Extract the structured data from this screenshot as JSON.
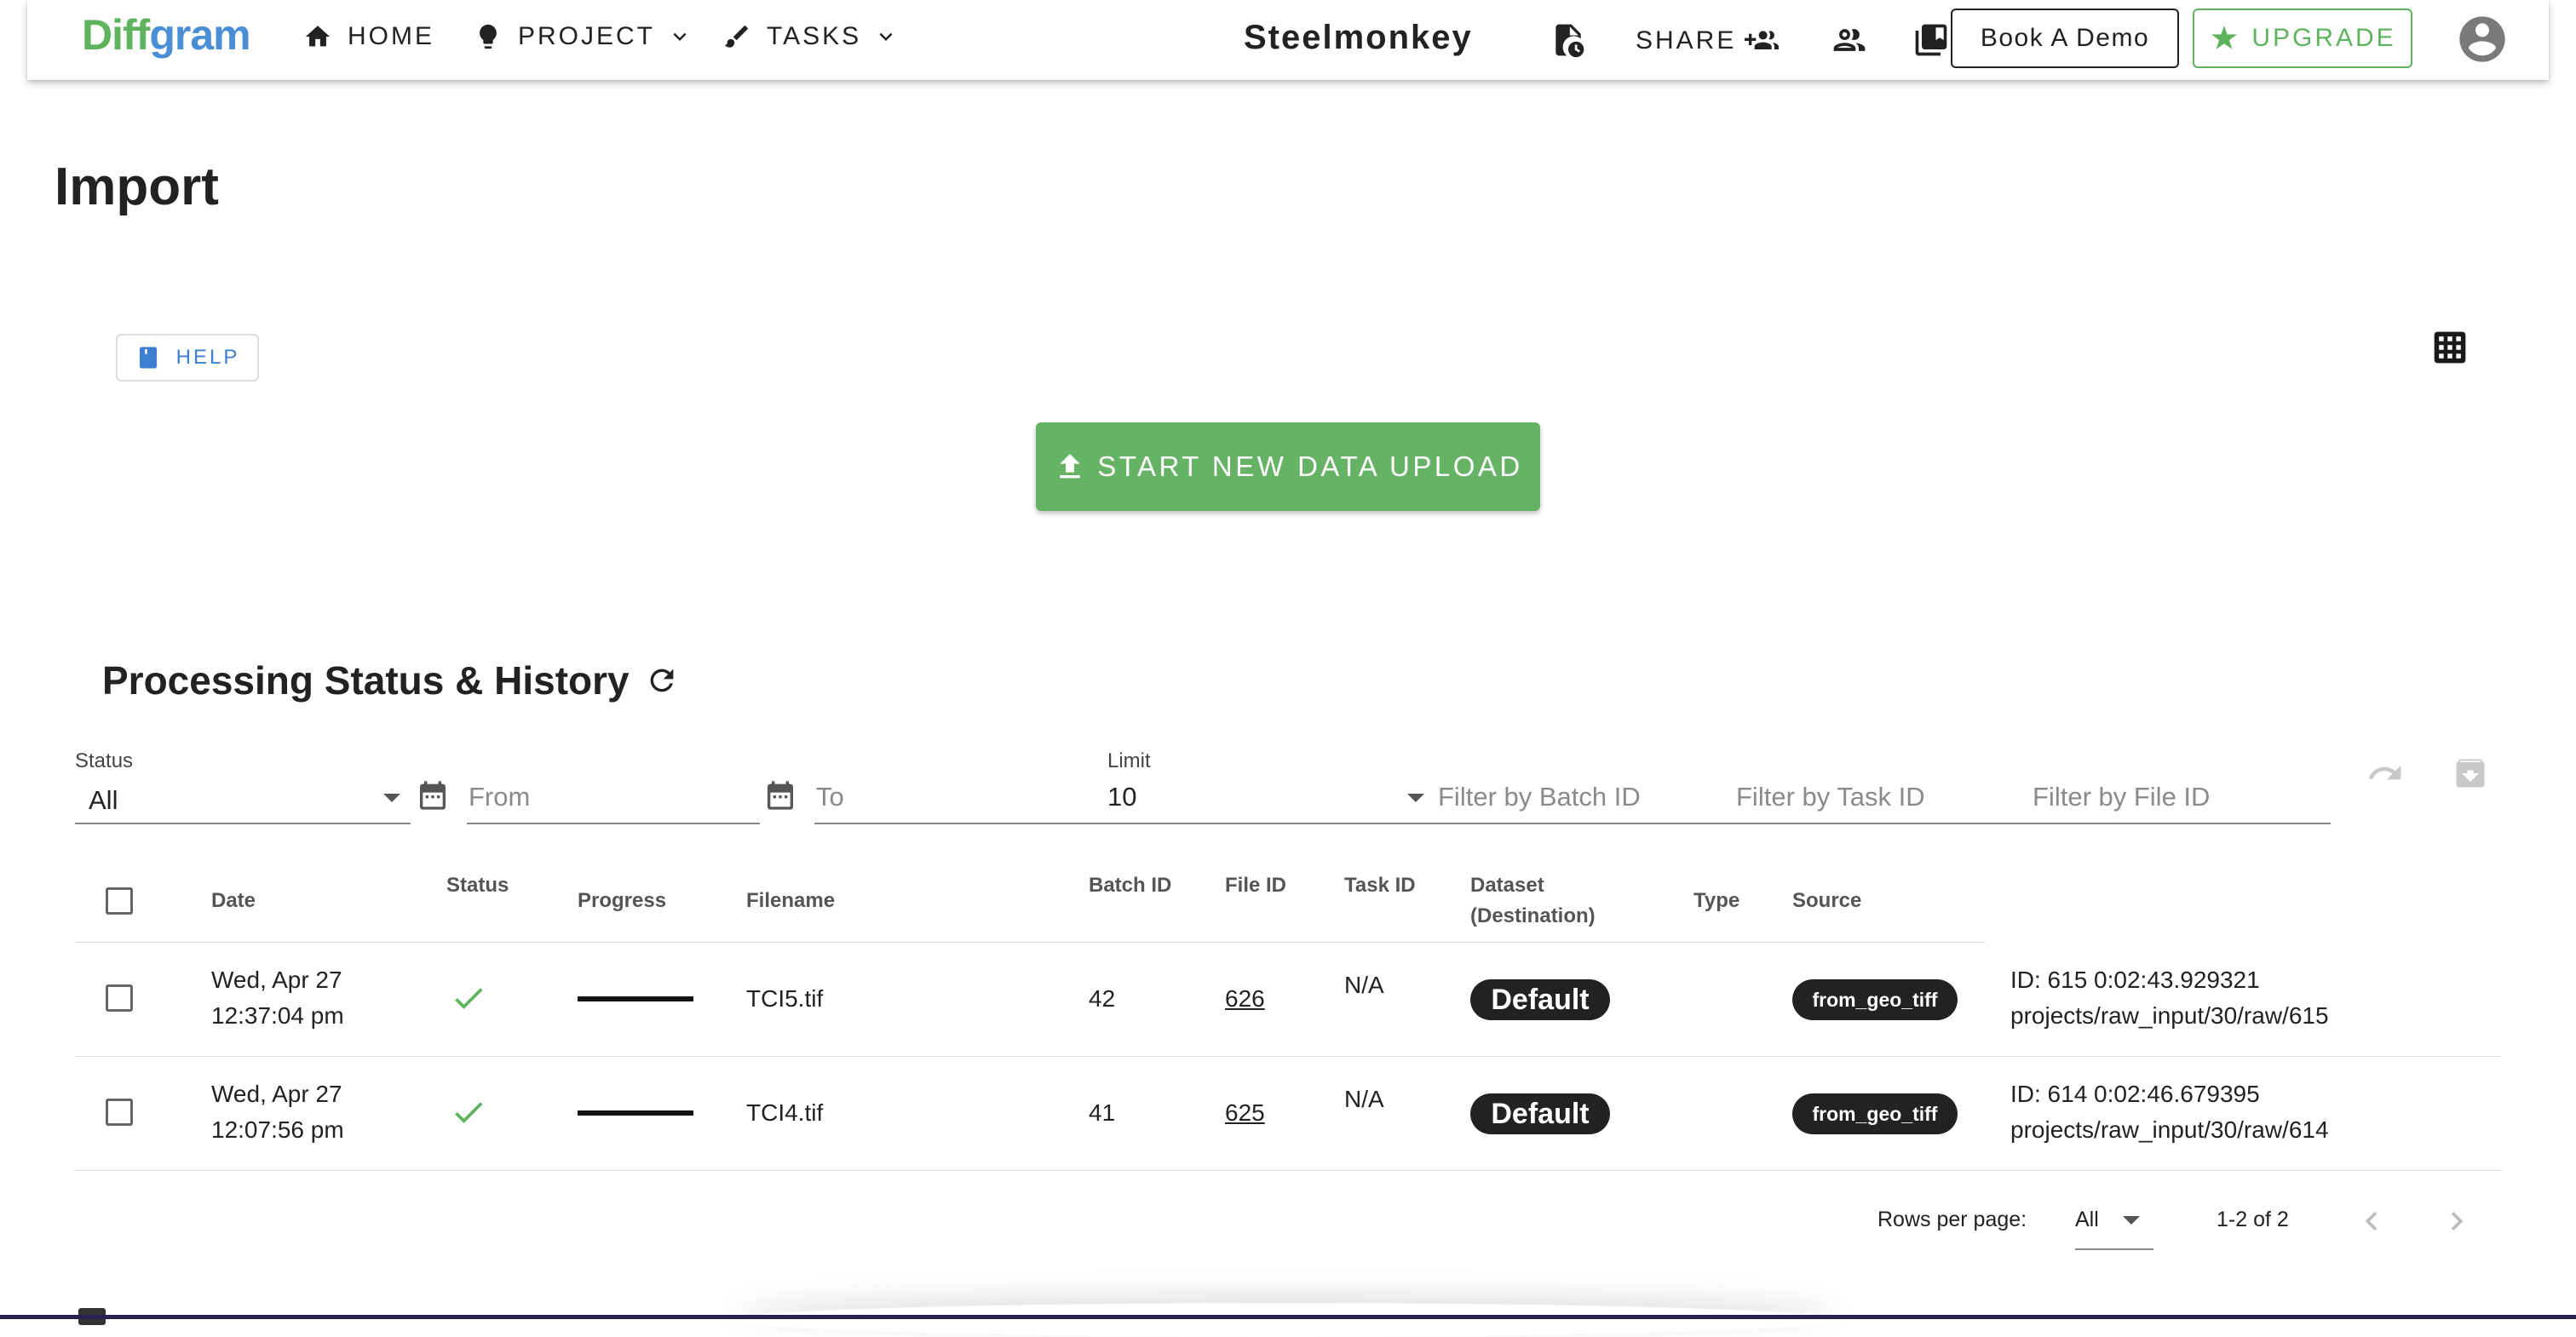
{
  "app": {
    "logo_part1": "Diff",
    "logo_part2": "gram",
    "workspace": "Steelmonkey"
  },
  "nav": {
    "home": "HOME",
    "project": "PROJECT",
    "tasks": "TASKS",
    "share": "SHARE",
    "book_demo": "Book A Demo",
    "upgrade": "UPGRADE"
  },
  "page": {
    "title": "Import",
    "help": "HELP",
    "upload_button": "START NEW DATA UPLOAD",
    "section_title": "Processing Status & History"
  },
  "filters": {
    "status_label": "Status",
    "status_value": "All",
    "from_placeholder": "From",
    "to_placeholder": "To",
    "limit_label": "Limit",
    "limit_value": "10",
    "batch_placeholder": "Filter by Batch ID",
    "task_placeholder": "Filter by Task ID",
    "file_placeholder": "Filter by File ID"
  },
  "table": {
    "headers": {
      "date": "Date",
      "status": "Status",
      "progress": "Progress",
      "filename": "Filename",
      "batch_id": "Batch ID",
      "file_id": "File ID",
      "task_id": "Task ID",
      "dataset_1": "Dataset",
      "dataset_2": "(Destination)",
      "type": "Type",
      "source": "Source"
    },
    "rows": [
      {
        "date_line1": "Wed, Apr 27",
        "date_line2": "12:37:04 pm",
        "progress": 1.0,
        "filename": "TCI5.tif",
        "batch_id": "42",
        "file_id": "626",
        "task_id": "N/A",
        "dataset": "Default",
        "source": "from_geo_tiff",
        "info_line1": "ID: 615 0:02:43.929321",
        "info_line2": "projects/raw_input/30/raw/615"
      },
      {
        "date_line1": "Wed, Apr 27",
        "date_line2": "12:07:56 pm",
        "progress": 1.0,
        "filename": "TCI4.tif",
        "batch_id": "41",
        "file_id": "625",
        "task_id": "N/A",
        "dataset": "Default",
        "source": "from_geo_tiff",
        "info_line1": "ID: 614 0:02:46.679395",
        "info_line2": "projects/raw_input/30/raw/614"
      }
    ]
  },
  "pagination": {
    "rows_per_page_label": "Rows per page:",
    "rows_per_page_value": "All",
    "range": "1-2 of 2"
  },
  "colors": {
    "brand_green": "#5fb35f",
    "brand_blue": "#4a8fd6",
    "upload_green": "#66b366",
    "help_blue": "#3b7fd1"
  }
}
